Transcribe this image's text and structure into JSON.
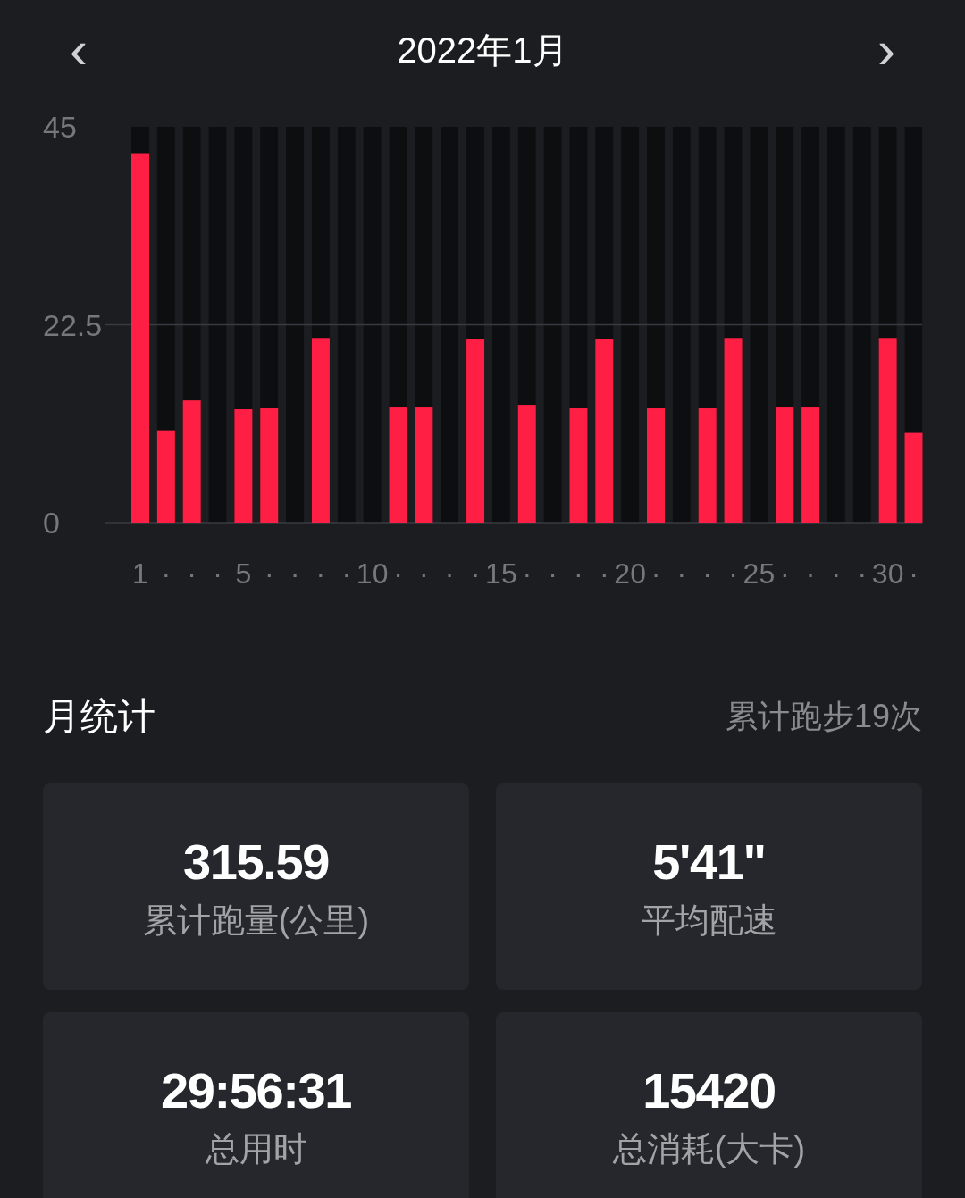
{
  "header": {
    "title": "2022年1月",
    "prev": "‹",
    "next": "›"
  },
  "chart": {
    "chart_data": {
      "type": "bar",
      "categories": [
        "1",
        "·",
        "·",
        "·",
        "5",
        "·",
        "·",
        "·",
        "·",
        "10",
        "·",
        "·",
        "·",
        "·",
        "15",
        "·",
        "·",
        "·",
        "·",
        "20",
        "·",
        "·",
        "·",
        "·",
        "25",
        "·",
        "·",
        "·",
        "·",
        "30",
        "·"
      ],
      "series": [
        {
          "color": "#ff1f44",
          "values": [
            42,
            10.5,
            13.9,
            null,
            12.9,
            13,
            null,
            21,
            null,
            null,
            13.1,
            13.1,
            null,
            20.9,
            null,
            13.4,
            null,
            13,
            20.9,
            null,
            13,
            null,
            13,
            21,
            null,
            13.1,
            13.1,
            null,
            null,
            21,
            10.2
          ]
        }
      ],
      "ylim": [
        0,
        45
      ],
      "yticks": [
        0,
        22.5,
        45
      ]
    }
  },
  "summary": {
    "title": "月统计",
    "count": "累计跑步19次"
  },
  "stats": [
    {
      "value": "315.59",
      "label": "累计跑量(公里)"
    },
    {
      "value": "5'41\"",
      "label": "平均配速"
    },
    {
      "value": "29:56:31",
      "label": "总用时"
    },
    {
      "value": "15420",
      "label": "总消耗(大卡)"
    }
  ]
}
